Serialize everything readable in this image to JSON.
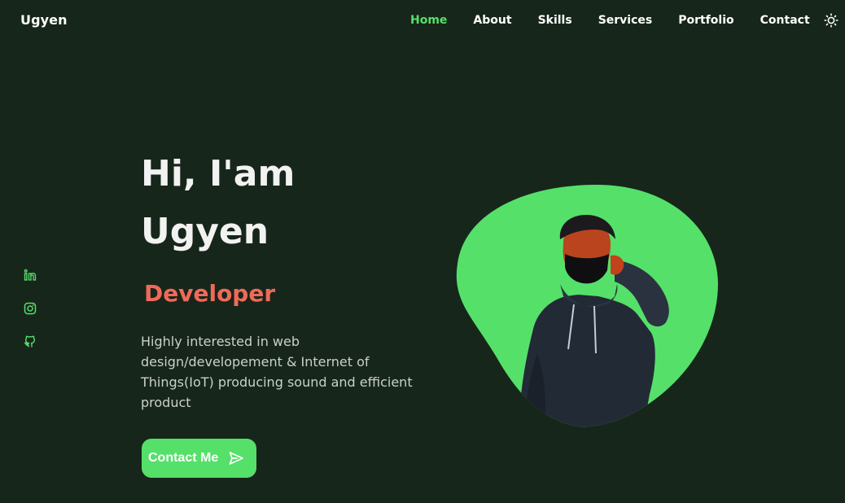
{
  "header": {
    "logo": "Ugyen",
    "nav": [
      {
        "label": "Home",
        "active": true
      },
      {
        "label": "About",
        "active": false
      },
      {
        "label": "Skills",
        "active": false
      },
      {
        "label": "Services",
        "active": false
      },
      {
        "label": "Portfolio",
        "active": false
      },
      {
        "label": "Contact",
        "active": false
      }
    ],
    "theme_icon": "sun-icon"
  },
  "social": [
    {
      "icon": "linkedin-icon"
    },
    {
      "icon": "instagram-icon"
    },
    {
      "icon": "github-icon"
    }
  ],
  "hero": {
    "title_line1": "Hi, I'am",
    "title_line2": "Ugyen",
    "subtitle": "Developer",
    "description": "Highly interested in web design/developement & Internet of Things(IoT) producing sound and efficient product",
    "cta_label": "Contact Me",
    "cta_icon": "send-icon"
  },
  "colors": {
    "background": "#17261a",
    "accent": "#55e06a",
    "subtitle": "#ef6a5a",
    "text": "#ffffff",
    "muted_text": "#c9d1ca"
  }
}
